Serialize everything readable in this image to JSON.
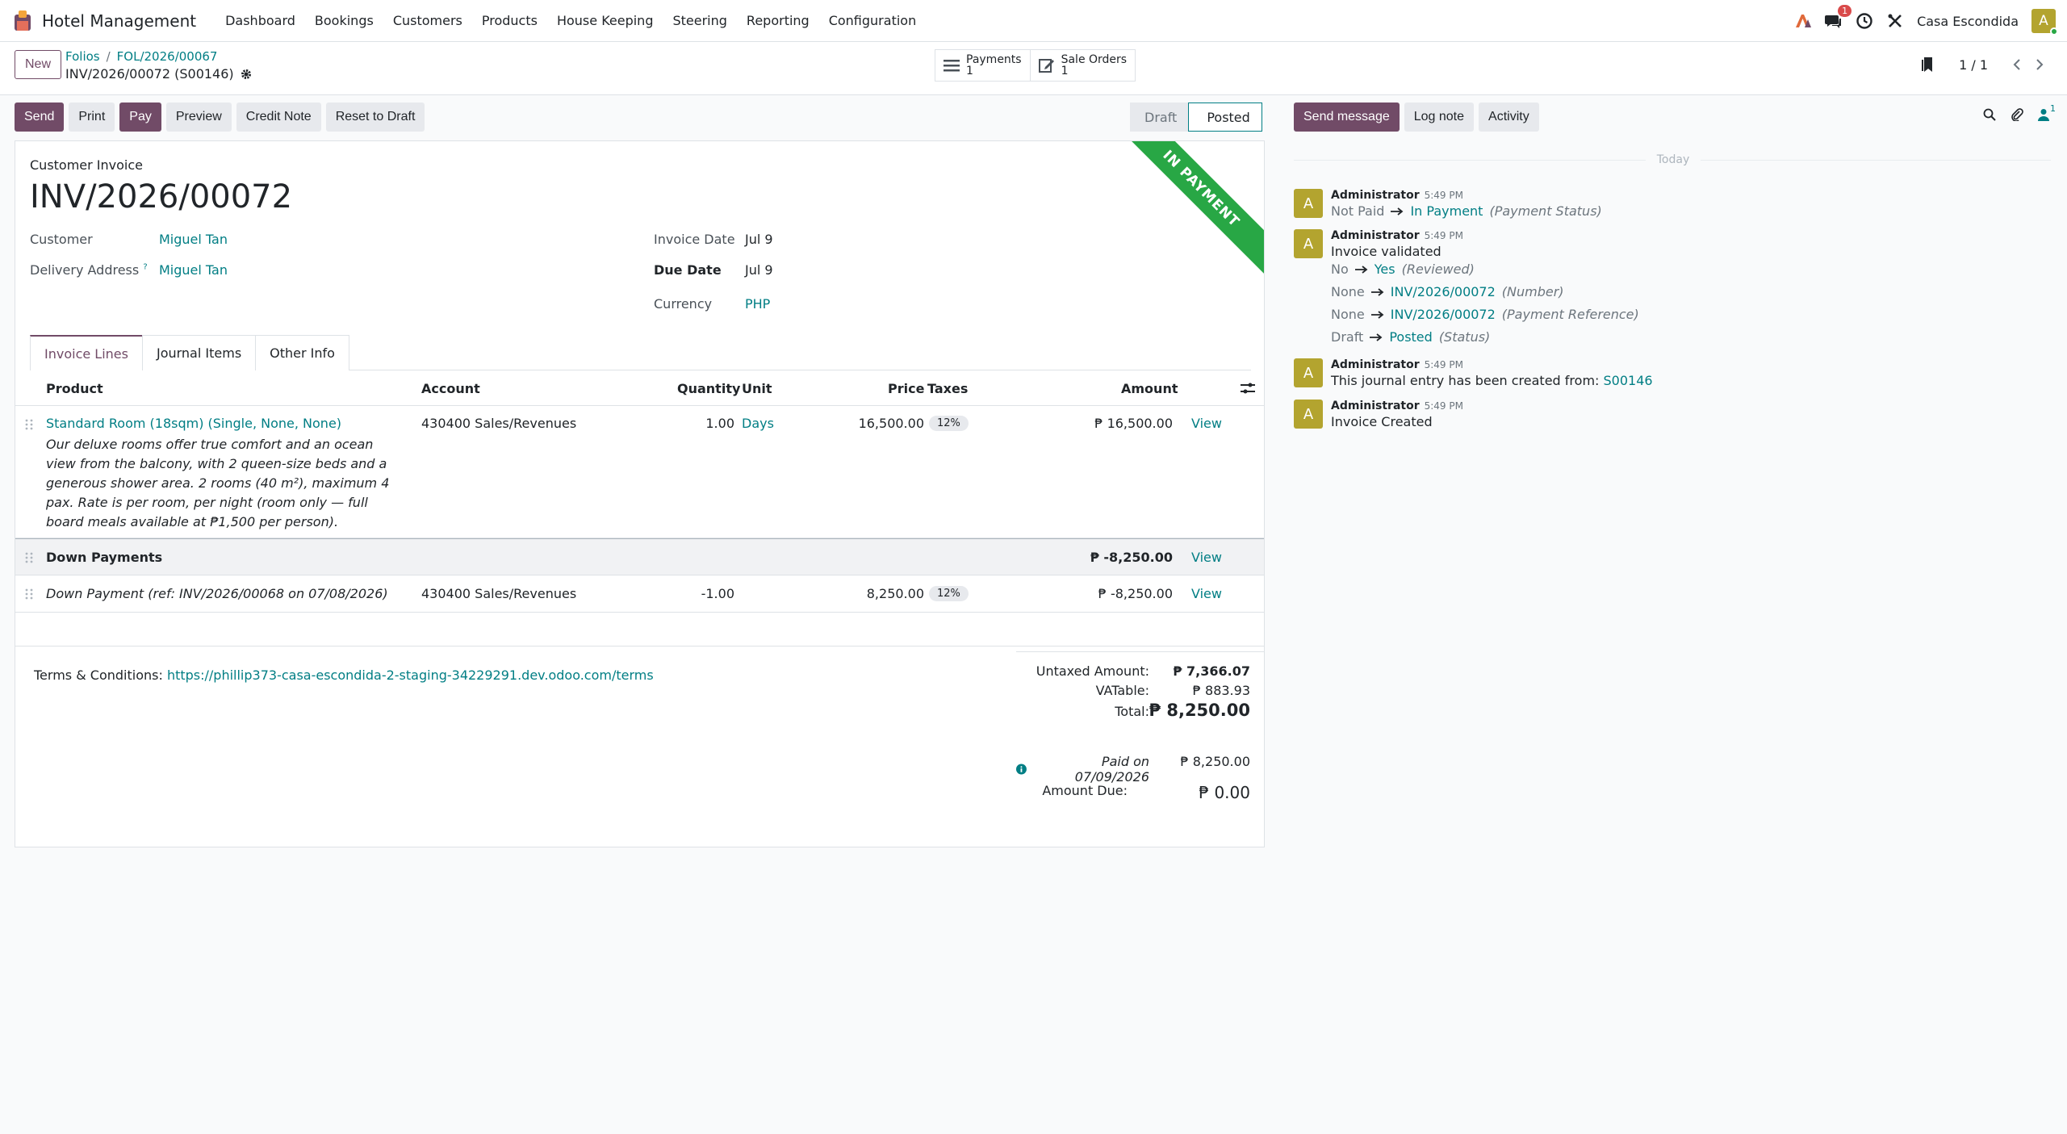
{
  "nav": {
    "app_name": "Hotel Management",
    "menu": [
      "Dashboard",
      "Bookings",
      "Customers",
      "Products",
      "House Keeping",
      "Steering",
      "Reporting",
      "Configuration"
    ],
    "message_count": "1",
    "company": "Casa Escondida",
    "user_initial": "A"
  },
  "control": {
    "new_label": "New",
    "breadcrumb": [
      "Folios",
      "FOL/2026/00067"
    ],
    "record_title": "INV/2026/00072 (S00146)",
    "smart_buttons": [
      {
        "label": "Payments",
        "count": "1"
      },
      {
        "label": "Sale Orders",
        "count": "1"
      }
    ],
    "pager": "1 / 1"
  },
  "actions": {
    "buttons": [
      "Send",
      "Print",
      "Pay",
      "Preview",
      "Credit Note",
      "Reset to Draft"
    ],
    "stages": [
      "Draft",
      "Posted"
    ],
    "active_stage": "Posted"
  },
  "invoice": {
    "ribbon": "IN PAYMENT",
    "kind": "Customer Invoice",
    "name": "INV/2026/00072",
    "customer_label": "Customer",
    "customer": "Miguel Tan",
    "delivery_label": "Delivery Address",
    "delivery_help": "?",
    "delivery": "Miguel Tan",
    "invoice_date_label": "Invoice Date",
    "invoice_date": "Jul 9",
    "due_date_label": "Due Date",
    "due_date": "Jul 9",
    "currency_label": "Currency",
    "currency": "PHP",
    "tabs": [
      "Invoice Lines",
      "Journal Items",
      "Other Info"
    ],
    "columns": {
      "product": "Product",
      "account": "Account",
      "quantity": "Quantity",
      "unit": "Unit",
      "price": "Price",
      "taxes": "Taxes",
      "amount": "Amount"
    },
    "lines": [
      {
        "product": "Standard Room (18sqm) (Single, None, None)",
        "description": "Our deluxe rooms offer true comfort and an ocean view from the balcony, with 2 queen-size beds and a generous shower area. 2 rooms (40 m²), maximum 4 pax. Rate is per room, per night (room only — full board meals available at ₱1,500 per person).",
        "account": "430400 Sales/Revenues",
        "quantity": "1.00",
        "unit": "Days",
        "price": "16,500.00",
        "tax": "12%",
        "amount": "₱ 16,500.00",
        "view": "View"
      }
    ],
    "section": {
      "label": "Down Payments",
      "amount": "₱ -8,250.00",
      "view": "View"
    },
    "down_payment": {
      "product": "Down Payment (ref: INV/2026/00068 on 07/08/2026)",
      "account": "430400 Sales/Revenues",
      "quantity": "-1.00",
      "price": "8,250.00",
      "tax": "12%",
      "amount": "₱ -8,250.00",
      "view": "View"
    },
    "terms_label": "Terms & Conditions:",
    "terms_link": "https://phillip373-casa-escondida-2-staging-34229291.dev.odoo.com/terms",
    "totals": {
      "untaxed_label": "Untaxed Amount:",
      "untaxed": "₱ 7,366.07",
      "vat_label": "VATable:",
      "vat": "₱ 883.93",
      "total_label": "Total:",
      "total": "₱ 8,250.00",
      "paid_label": "Paid on 07/09/2026",
      "paid": "₱ 8,250.00",
      "due_label": "Amount Due:",
      "due": "₱ 0.00"
    }
  },
  "chatter": {
    "buttons": [
      "Send message",
      "Log note",
      "Activity"
    ],
    "follower_count": "1",
    "today": "Today",
    "messages": [
      {
        "avatar": "A",
        "author": "Administrator",
        "time": "5:49 PM"
      },
      {
        "avatar": "A",
        "author": "Administrator",
        "time": "5:49 PM"
      },
      {
        "avatar": "A",
        "author": "Administrator",
        "time": "5:49 PM"
      },
      {
        "avatar": "A",
        "author": "Administrator",
        "time": "5:49 PM"
      }
    ],
    "m1": {
      "old": "Not Paid",
      "new": "In Payment",
      "field": "(Payment Status)"
    },
    "m2": {
      "text": "Invoice validated",
      "c1": {
        "old": "No",
        "new": "Yes",
        "field": "(Reviewed)"
      },
      "c2": {
        "old": "None",
        "new": "INV/2026/00072",
        "field": "(Number)"
      },
      "c3": {
        "old": "None",
        "new": "INV/2026/00072",
        "field": "(Payment Reference)"
      },
      "c4": {
        "old": "Draft",
        "new": "Posted",
        "field": "(Status)"
      }
    },
    "m3": {
      "text": "This journal entry has been created from:",
      "link": "S00146"
    },
    "m4": {
      "text": "Invoice Created"
    }
  },
  "colors": {
    "brand": "#714b67",
    "link": "#017e84",
    "ribbon": "#28a745",
    "avatar": "#b3a42f"
  }
}
